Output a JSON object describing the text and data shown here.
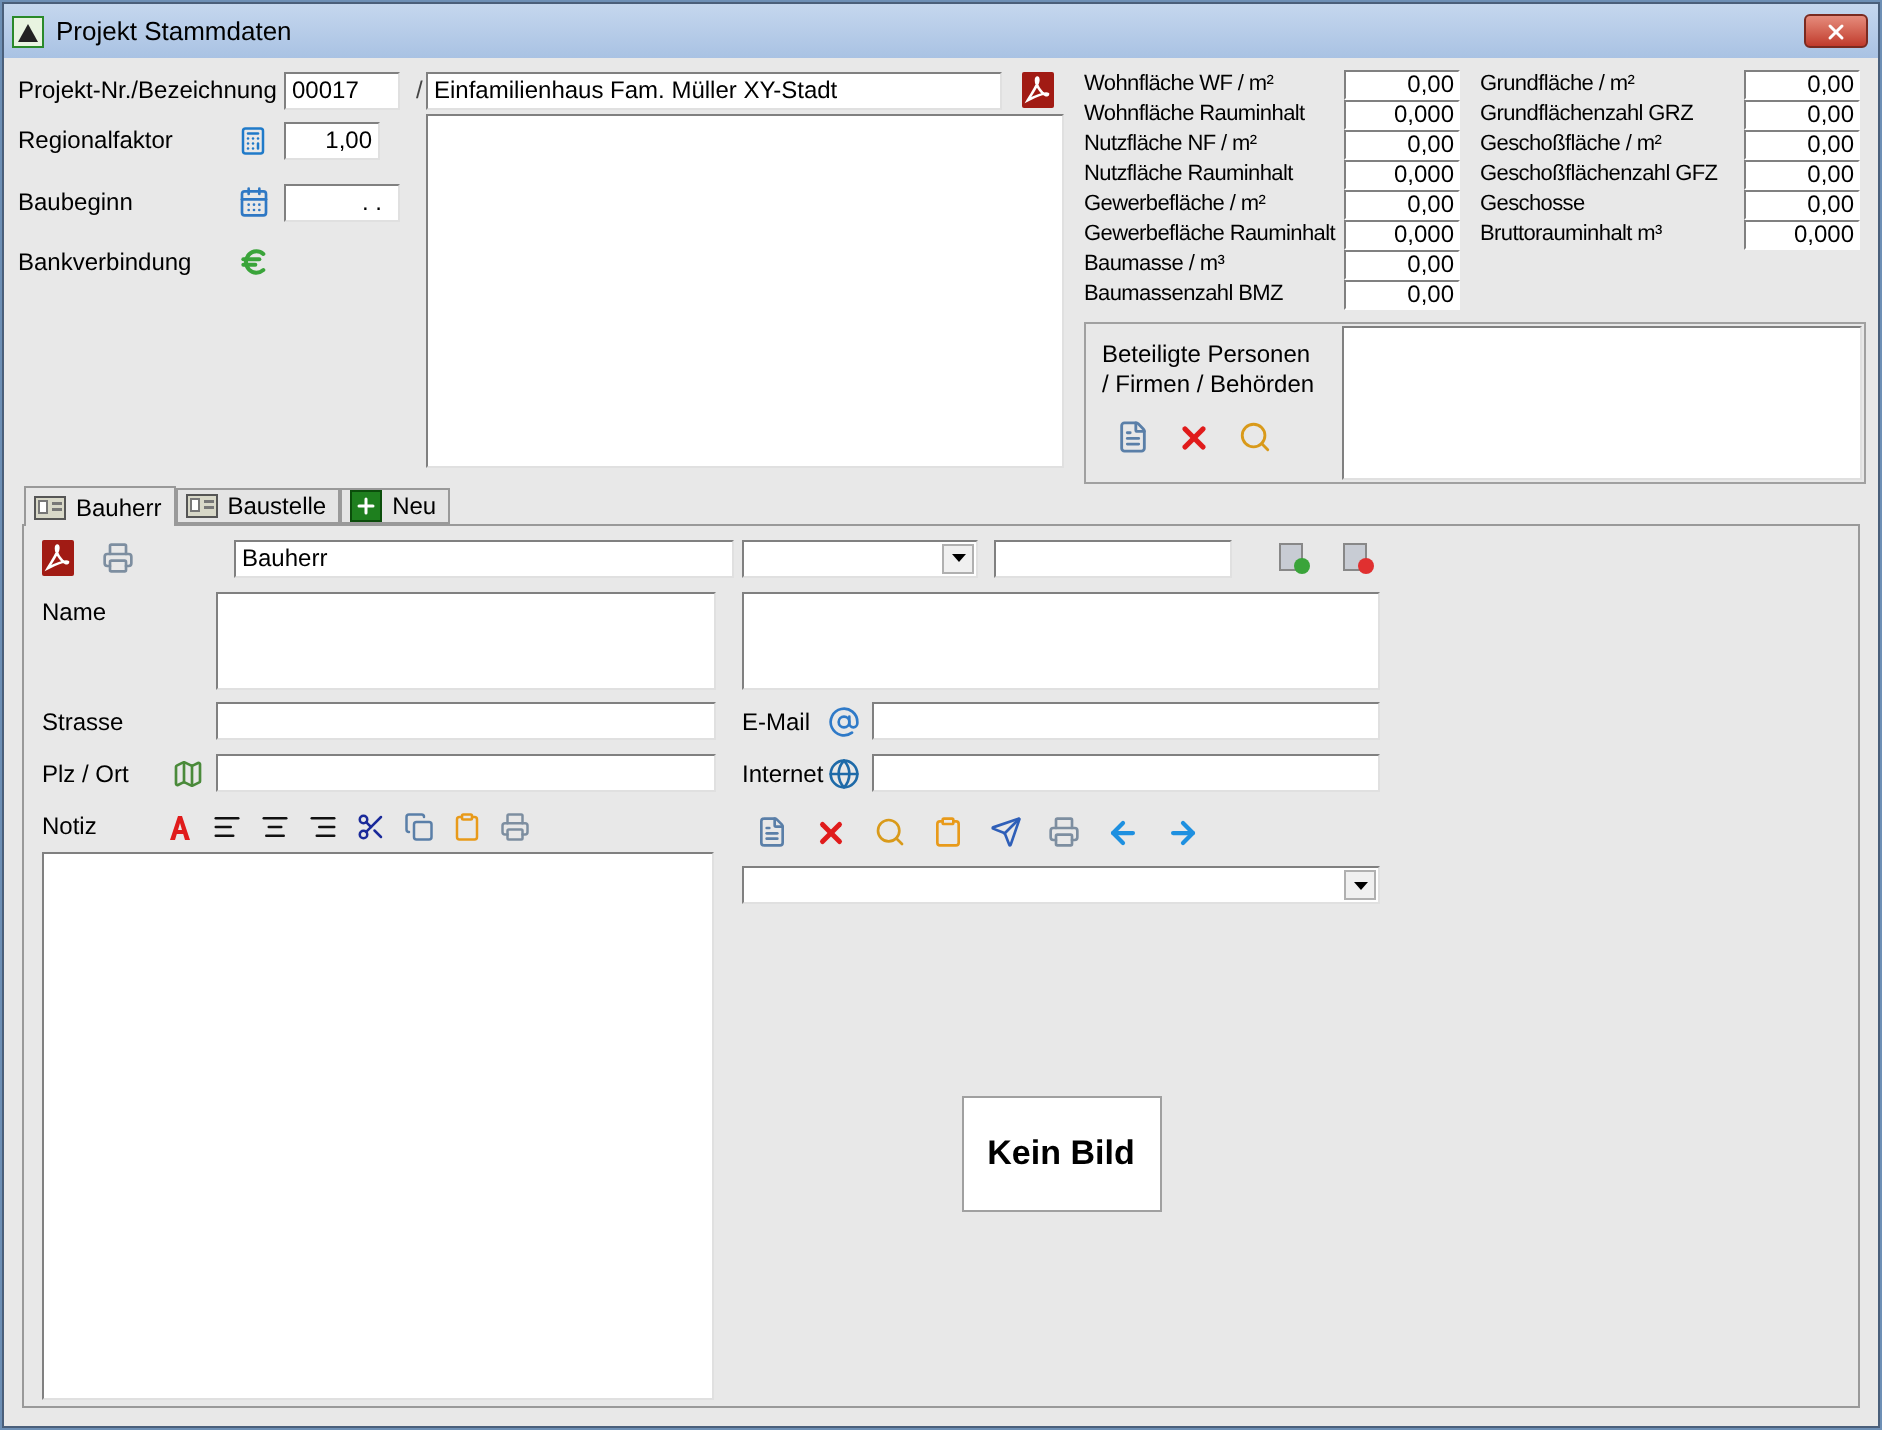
{
  "window": {
    "title": "Projekt Stammdaten"
  },
  "project": {
    "label": "Projekt-Nr./Bezeichnung",
    "number": "00017",
    "separator": "/",
    "name": "Einfamilienhaus Fam. Müller XY-Stadt"
  },
  "regional": {
    "label": "Regionalfaktor",
    "value": "1,00"
  },
  "start": {
    "label": "Baubeginn",
    "value": ". ."
  },
  "bank": {
    "label": "Bankverbindung"
  },
  "metrics_left": [
    {
      "label": "Wohnfläche WF / m²",
      "value": "0,00"
    },
    {
      "label": "Wohnfläche Rauminhalt",
      "value": "0,000"
    },
    {
      "label": "Nutzfläche NF / m²",
      "value": "0,00"
    },
    {
      "label": "Nutzfläche Rauminhalt",
      "value": "0,000"
    },
    {
      "label": "Gewerbefläche / m²",
      "value": "0,00"
    },
    {
      "label": "Gewerbefläche Rauminhalt",
      "value": "0,000"
    },
    {
      "label": "Baumasse / m³",
      "value": "0,00"
    },
    {
      "label": "Baumassenzahl BMZ",
      "value": "0,00"
    }
  ],
  "metrics_right": [
    {
      "label": "Grundfläche / m²",
      "value": "0,00"
    },
    {
      "label": "Grundflächenzahl GRZ",
      "value": "0,00"
    },
    {
      "label": "Geschoßfläche / m²",
      "value": "0,00"
    },
    {
      "label": "Geschoßflächenzahl GFZ",
      "value": "0,00"
    },
    {
      "label": "Geschosse",
      "value": "0,00"
    },
    {
      "label": "Bruttorauminhalt m³",
      "value": "0,000"
    }
  ],
  "participants": {
    "label": "Beteiligte Personen / Firmen / Behörden"
  },
  "tabs": [
    {
      "label": "Bauherr",
      "selected": true,
      "kind": "card"
    },
    {
      "label": "Baustelle",
      "selected": false,
      "kind": "card"
    },
    {
      "label": "Neu",
      "selected": false,
      "kind": "add"
    }
  ],
  "contact": {
    "role": "Bauherr",
    "name_label": "Name",
    "street_label": "Strasse",
    "city_label": "Plz / Ort",
    "note_label": "Notiz",
    "email_label": "E-Mail",
    "internet_label": "Internet"
  },
  "image_placeholder": "Kein Bild"
}
